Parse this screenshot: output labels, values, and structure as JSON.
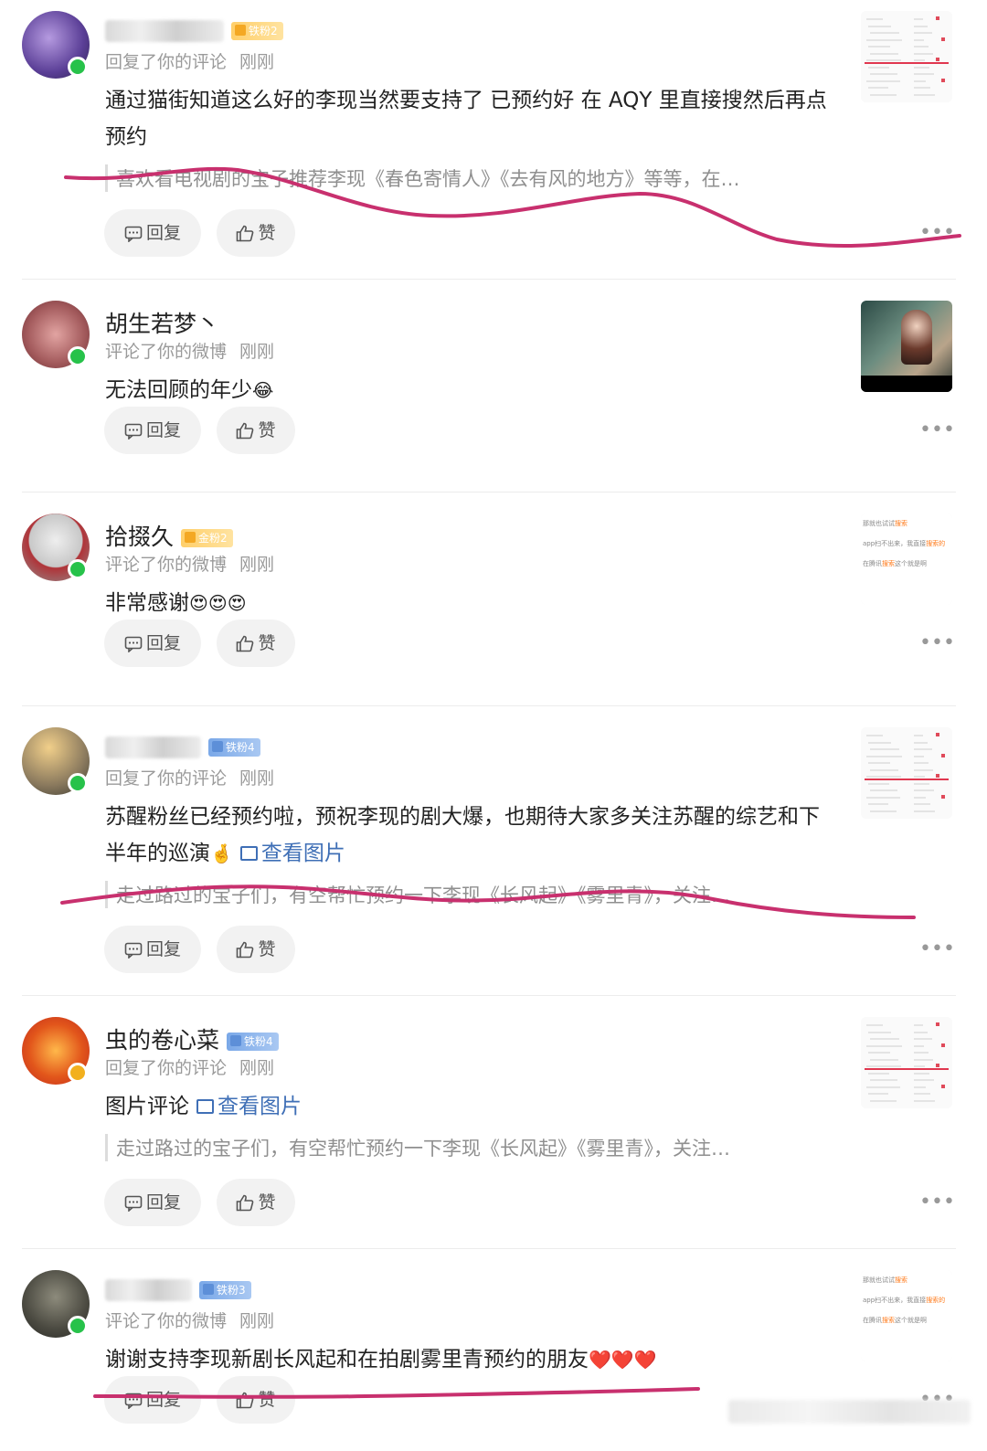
{
  "notifications": [
    {
      "username": "",
      "badge": "铁粉2",
      "badge_kind": "gold",
      "action": "回复了你的评论",
      "time": "刚刚",
      "content": "通过猫街知道这么好的李现当然要支持了 已预约好 在 AQY 里直接搜然后再点预约",
      "quote": "喜欢看电视剧的宝子推荐李现《春色寄情人》《去有风的地方》等等，在…",
      "reply_label": "回复",
      "like_label": "赞",
      "thumb_type": "sheet"
    },
    {
      "username": "胡生若梦丶",
      "badge": "",
      "action": "评论了你的微博",
      "time": "刚刚",
      "content": "无法回顾的年少",
      "content_emoji": "😂",
      "reply_label": "回复",
      "like_label": "赞",
      "thumb_type": "video"
    },
    {
      "username": "拾掇久",
      "badge": "金粉2",
      "badge_kind": "gold",
      "action": "评论了你的微博",
      "time": "刚刚",
      "content": "非常感谢",
      "content_emoji": "😍😍😍",
      "reply_label": "回复",
      "like_label": "赞",
      "thumb_type": "text"
    },
    {
      "username": "",
      "badge": "铁粉4",
      "badge_kind": "iron",
      "action": "回复了你的评论",
      "time": "刚刚",
      "content": "苏醒粉丝已经预约啦，预祝李现的剧大爆，也期待大家多关注苏醒的综艺和下半年的巡演",
      "content_emoji": "🤞",
      "link_text": "查看图片",
      "quote": "走过路过的宝子们，有空帮忙预约一下李现《长风起》《雾里青》，关注…",
      "reply_label": "回复",
      "like_label": "赞",
      "thumb_type": "sheet"
    },
    {
      "username": "虫的卷心菜",
      "badge": "铁粉4",
      "badge_kind": "iron",
      "action": "回复了你的评论",
      "time": "刚刚",
      "content": "图片评论",
      "link_text": "查看图片",
      "quote": "走过路过的宝子们，有空帮忙预约一下李现《长风起》《雾里青》，关注…",
      "reply_label": "回复",
      "like_label": "赞",
      "thumb_type": "sheet"
    },
    {
      "username": "",
      "badge": "铁粉3",
      "badge_kind": "iron",
      "action": "评论了你的微博",
      "time": "刚刚",
      "content": "谢谢支持李现新剧长风起和在拍剧雾里青预约的朋友",
      "content_emoji": "❤️❤️❤️",
      "reply_label": "回复",
      "like_label": "赞",
      "thumb_type": "text"
    }
  ],
  "thumb_text": {
    "line1": "那就也试试",
    "line1_hl": "搜索",
    "line2": "app扫不出来，我直接",
    "line2_hl": "搜索的",
    "line3": "在腾讯",
    "line3_hl": "搜索",
    "line3_tail": "这个就是啊"
  },
  "more_label": "•••",
  "colors": {
    "accent_link": "#3f6fb6",
    "annotation_stroke": "#c8306e",
    "online_dot": "#27c24a"
  }
}
